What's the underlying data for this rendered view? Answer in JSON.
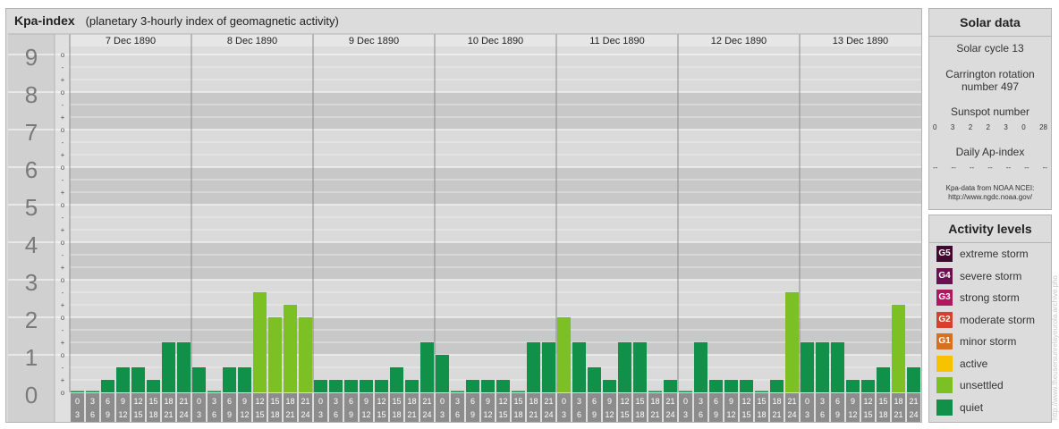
{
  "header": {
    "title": "Kpa-index",
    "subtitle": "(planetary 3-hourly index of geomagnetic activity)"
  },
  "colors": {
    "quiet": "#11904a",
    "unsettled": "#7cc023",
    "active": "#f7c300",
    "g1": "#d8701d",
    "g2": "#d4412c",
    "g3": "#b0175f",
    "g4": "#6d0f4f",
    "g5": "#400a2e"
  },
  "chart_data": {
    "type": "bar",
    "ylim": [
      0,
      9
    ],
    "y_ticks": [
      "0",
      "1",
      "2",
      "3",
      "4",
      "5",
      "6",
      "7",
      "8",
      "9"
    ],
    "minor_tick_labels": [
      "o",
      "+",
      "-"
    ],
    "days": [
      "7 Dec 1890",
      "8 Dec 1890",
      "9 Dec 1890",
      "10 Dec 1890",
      "11 Dec 1890",
      "12 Dec 1890",
      "13 Dec 1890"
    ],
    "interval_starts": [
      "0",
      "3",
      "6",
      "9",
      "12",
      "15",
      "18",
      "21"
    ],
    "interval_ends": [
      "3",
      "6",
      "9",
      "12",
      "15",
      "18",
      "21",
      "24"
    ],
    "values": [
      [
        0,
        0,
        0.333,
        0.667,
        0.667,
        0.333,
        1.333,
        1.333
      ],
      [
        0.667,
        0,
        0.667,
        0.667,
        2.667,
        2,
        2.333,
        2
      ],
      [
        0.333,
        0.333,
        0.333,
        0.333,
        0.333,
        0.667,
        0.333,
        1.333
      ],
      [
        1,
        0,
        0.333,
        0.333,
        0.333,
        0,
        1.333,
        1.333
      ],
      [
        2,
        1.333,
        0.667,
        0.333,
        1.333,
        1.333,
        0,
        0.333
      ],
      [
        0,
        1.333,
        0.333,
        0.333,
        0.333,
        0,
        0.333,
        2.667
      ],
      [
        1.333,
        1.333,
        1.333,
        0.333,
        0.333,
        0.667,
        2.333,
        0.667
      ]
    ]
  },
  "solar": {
    "title": "Solar data",
    "cycle": "Solar cycle 13",
    "carrington": "Carrington rotation number 497",
    "sunspot_label": "Sunspot number",
    "sunspots": [
      "0",
      "3",
      "2",
      "2",
      "3",
      "0",
      "28"
    ],
    "ap_label": "Daily Ap-index",
    "ap_values": [
      "--",
      "--",
      "--",
      "--",
      "--",
      "--",
      "--"
    ],
    "source_line1": "Kpa-data from NOAA NCEI:",
    "source_line2": "http://www.ngdc.noaa.gov/"
  },
  "activity": {
    "title": "Activity levels",
    "levels": [
      {
        "badge": "G5",
        "label": "extreme storm",
        "color": "#400a2e"
      },
      {
        "badge": "G4",
        "label": "severe storm",
        "color": "#6d0f4f"
      },
      {
        "badge": "G3",
        "label": "strong storm",
        "color": "#b0175f"
      },
      {
        "badge": "G2",
        "label": "moderate storm",
        "color": "#d4412c"
      },
      {
        "badge": "G1",
        "label": "minor storm",
        "color": "#d8701d"
      },
      {
        "badge": "",
        "label": "active",
        "color": "#f7c300"
      },
      {
        "badge": "",
        "label": "unsettled",
        "color": "#7cc023"
      },
      {
        "badge": "",
        "label": "quiet",
        "color": "#11904a"
      }
    ]
  },
  "watermark": "http://www.theusersunrelayeurola.archive.pho"
}
